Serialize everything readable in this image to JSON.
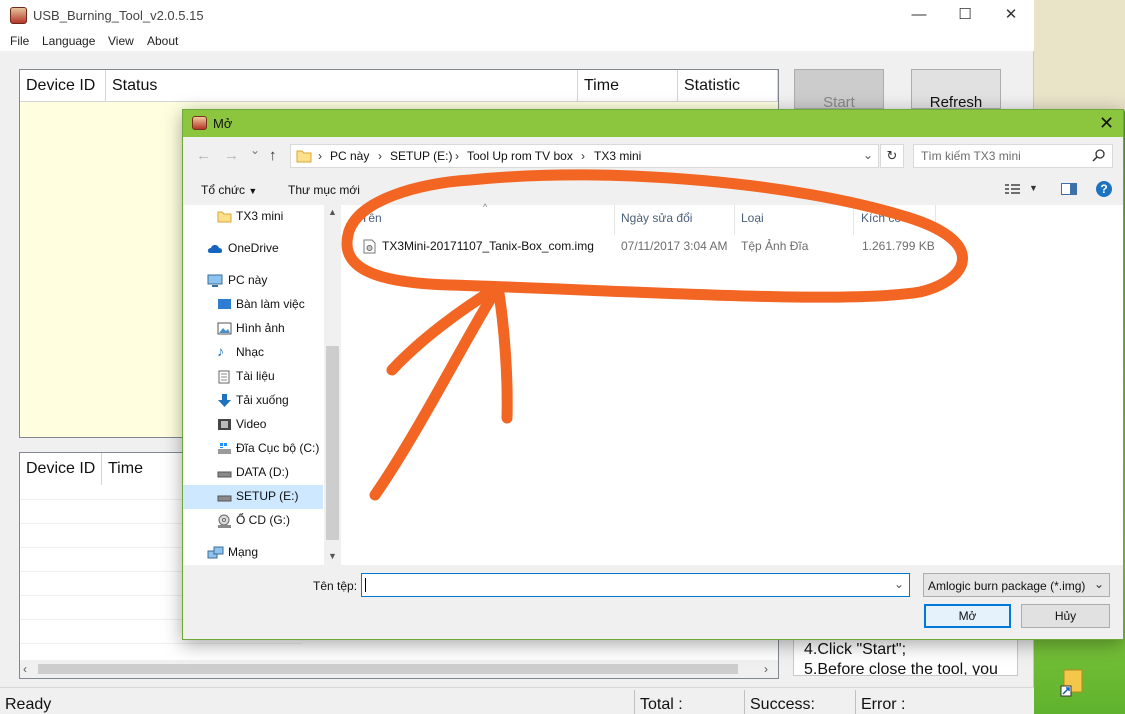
{
  "app": {
    "title": "USB_Burning_Tool_v2.0.5.15",
    "window_controls": {
      "minimize": "—",
      "maximize": "☐",
      "close": "✕"
    },
    "menu": [
      "File",
      "Language",
      "View",
      "About"
    ],
    "device_table": {
      "headers": [
        "Device ID",
        "Status",
        "Time",
        "Statistic"
      ]
    },
    "start_label": "Start",
    "refresh_label": "Refresh",
    "log_table": {
      "headers": [
        "Device ID",
        "Time"
      ]
    },
    "instructions": [
      "4.Click \"Start\";",
      "5.Before close the tool, you"
    ],
    "status_bar": {
      "ready": "Ready",
      "total": "Total :",
      "success": "Success:",
      "error": "Error :"
    }
  },
  "dialog": {
    "title": "Mở",
    "close": "✕",
    "nav": {
      "back": "←",
      "forward": "→",
      "recent": "⌄",
      "up": "↑"
    },
    "breadcrumbs": [
      "PC này",
      "SETUP (E:)",
      "Tool Up rom TV box",
      "TX3 mini"
    ],
    "refresh_glyph": "↻",
    "search_placeholder": "Tìm kiếm TX3 mini",
    "toolbar": {
      "organize": "Tổ chức",
      "new_folder": "Thư mục mới",
      "help": "?"
    },
    "nav_items": [
      {
        "label": "TX3 mini",
        "icon": "folder-icon"
      },
      {
        "label": "OneDrive",
        "icon": "cloud-icon"
      },
      {
        "label": "PC này",
        "icon": "computer-icon"
      },
      {
        "label": "Bàn làm việc",
        "icon": "desktop-icon"
      },
      {
        "label": "Hình ảnh",
        "icon": "pictures-icon"
      },
      {
        "label": "Nhạc",
        "icon": "music-icon"
      },
      {
        "label": "Tài liệu",
        "icon": "documents-icon"
      },
      {
        "label": "Tải xuống",
        "icon": "downloads-icon"
      },
      {
        "label": "Video",
        "icon": "video-icon"
      },
      {
        "label": "Đĩa Cục bộ (C:)",
        "icon": "drive-icon"
      },
      {
        "label": "DATA (D:)",
        "icon": "drive-icon"
      },
      {
        "label": "SETUP (E:)",
        "icon": "drive-icon",
        "selected": true
      },
      {
        "label": "Ổ CD (G:)",
        "icon": "cd-drive-icon"
      },
      {
        "label": "Mạng",
        "icon": "network-icon"
      }
    ],
    "columns": [
      "Tên",
      "Ngày sửa đổi",
      "Loại",
      "Kích cỡ"
    ],
    "files": [
      {
        "name": "TX3Mini-20171107_Tanix-Box_com.img",
        "modified": "07/11/2017 3:04 AM",
        "type": "Tệp Ảnh Đĩa",
        "size": "1.261.799 KB"
      }
    ],
    "filename_label": "Tên tệp:",
    "filename_value": "",
    "filter": "Amlogic burn package (*.img)",
    "open_label": "Mở",
    "cancel_label": "Hủy"
  },
  "annotation": {
    "color": "#f26522"
  }
}
